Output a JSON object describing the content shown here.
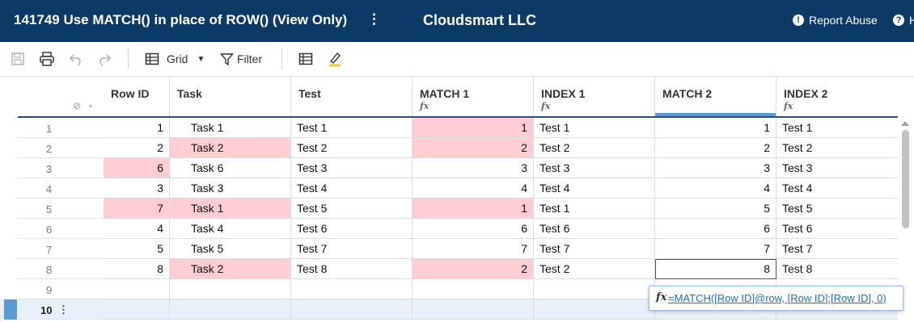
{
  "header": {
    "sheet_title": "141749 Use MATCH() in place of ROW() (View Only)",
    "title_menu": "⋮",
    "company": "Cloudsmart LLC",
    "report_abuse": "Report Abuse",
    "help": "H"
  },
  "toolbar": {
    "view_label": "Grid",
    "filter_label": "Filter"
  },
  "columns": [
    {
      "label": "Row ID",
      "fx": ""
    },
    {
      "label": "Task",
      "fx": ""
    },
    {
      "label": "Test",
      "fx": ""
    },
    {
      "label": "MATCH 1",
      "fx": "fx"
    },
    {
      "label": "INDEX 1",
      "fx": "fx"
    },
    {
      "label": "MATCH 2",
      "fx": ""
    },
    {
      "label": "INDEX 2",
      "fx": "fx"
    }
  ],
  "rows": [
    {
      "n": "1",
      "row_id": "1",
      "task": "Task 1",
      "test": "Test 1",
      "match1": "1",
      "index1": "Test 1",
      "match2": "1",
      "index2": "Test 1"
    },
    {
      "n": "2",
      "row_id": "2",
      "task": "Task 2",
      "test": "Test 2",
      "match1": "2",
      "index1": "Test 2",
      "match2": "2",
      "index2": "Test 2"
    },
    {
      "n": "3",
      "row_id": "6",
      "task": "Task 6",
      "test": "Test 3",
      "match1": "3",
      "index1": "Test 3",
      "match2": "3",
      "index2": "Test 3"
    },
    {
      "n": "4",
      "row_id": "3",
      "task": "Task 3",
      "test": "Test 4",
      "match1": "4",
      "index1": "Test 4",
      "match2": "4",
      "index2": "Test 4"
    },
    {
      "n": "5",
      "row_id": "7",
      "task": "Task 1",
      "test": "Test 5",
      "match1": "1",
      "index1": "Test 1",
      "match2": "5",
      "index2": "Test 5"
    },
    {
      "n": "6",
      "row_id": "4",
      "task": "Task 4",
      "test": "Test 6",
      "match1": "6",
      "index1": "Test 6",
      "match2": "6",
      "index2": "Test 6"
    },
    {
      "n": "7",
      "row_id": "5",
      "task": "Task 5",
      "test": "Test 7",
      "match1": "7",
      "index1": "Test 7",
      "match2": "7",
      "index2": "Test 7"
    },
    {
      "n": "8",
      "row_id": "8",
      "task": "Task 2",
      "test": "Test 8",
      "match1": "2",
      "index1": "Test 2",
      "match2": "8",
      "index2": "Test 8"
    },
    {
      "n": "9",
      "row_id": "",
      "task": "",
      "test": "",
      "match1": "",
      "index1": "",
      "match2": "",
      "index2": ""
    },
    {
      "n": "10",
      "row_id": "",
      "task": "",
      "test": "",
      "match1": "",
      "index1": "",
      "match2": "",
      "index2": ""
    }
  ],
  "highlight_color": "#ffcdd2",
  "formula": {
    "icon": "fx",
    "text": "=MATCH([Row ID]@row, [Row ID]:[Row ID], 0)"
  },
  "row_menu": "⋮"
}
